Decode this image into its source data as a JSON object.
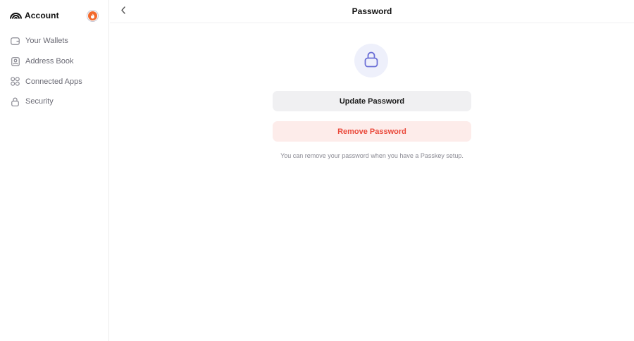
{
  "sidebar": {
    "brand": {
      "title": "Account",
      "logo_icon": "rainbow-arc-icon"
    },
    "avatar": {
      "icon": "flame-icon",
      "accent": "#f26a2e"
    },
    "items": [
      {
        "label": "Your Wallets",
        "icon": "wallet-icon"
      },
      {
        "label": "Address Book",
        "icon": "contact-book-icon"
      },
      {
        "label": "Connected Apps",
        "icon": "apps-grid-icon"
      },
      {
        "label": "Security",
        "icon": "lock-icon"
      }
    ]
  },
  "header": {
    "title": "Password",
    "back_icon": "chevron-left-icon"
  },
  "main": {
    "lock_icon": "lock-icon",
    "update_label": "Update Password",
    "remove_label": "Remove Password",
    "hint": "You can remove your password when you have a Passkey setup."
  },
  "colors": {
    "accent_lock": "#6b6fd6",
    "remove_text": "#ea4a3c",
    "remove_bg": "#fdecea",
    "update_bg": "#f0f0f2"
  }
}
